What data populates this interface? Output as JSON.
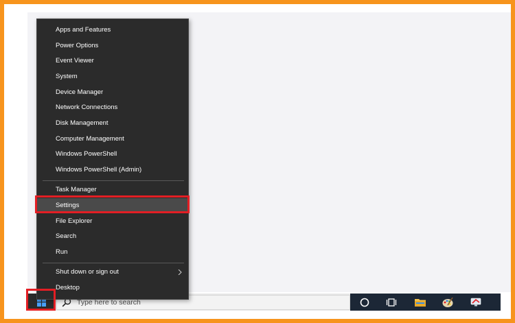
{
  "context_menu": {
    "items": [
      {
        "label": "Apps and Features"
      },
      {
        "label": "Power Options"
      },
      {
        "label": "Event Viewer"
      },
      {
        "label": "System"
      },
      {
        "label": "Device Manager"
      },
      {
        "label": "Network Connections"
      },
      {
        "label": "Disk Management"
      },
      {
        "label": "Computer Management"
      },
      {
        "label": "Windows PowerShell"
      },
      {
        "label": "Windows PowerShell (Admin)"
      },
      {
        "label": "Task Manager"
      },
      {
        "label": "Settings",
        "selected": true
      },
      {
        "label": "File Explorer"
      },
      {
        "label": "Search"
      },
      {
        "label": "Run"
      },
      {
        "label": "Shut down or sign out",
        "submenu": true
      },
      {
        "label": "Desktop"
      }
    ]
  },
  "taskbar": {
    "search_placeholder": "Type here to search",
    "icons": [
      "start-windows-icon",
      "search-icon",
      "cortana-circle-icon",
      "task-view-icon",
      "file-explorer-folder-icon",
      "paint-palette-icon",
      "remote-desktop-icon"
    ]
  },
  "colors": {
    "frame": "#f7941d",
    "highlight": "#e31e24",
    "menu_bg": "#2b2b2b",
    "taskbar_dark": "#1c2736"
  }
}
